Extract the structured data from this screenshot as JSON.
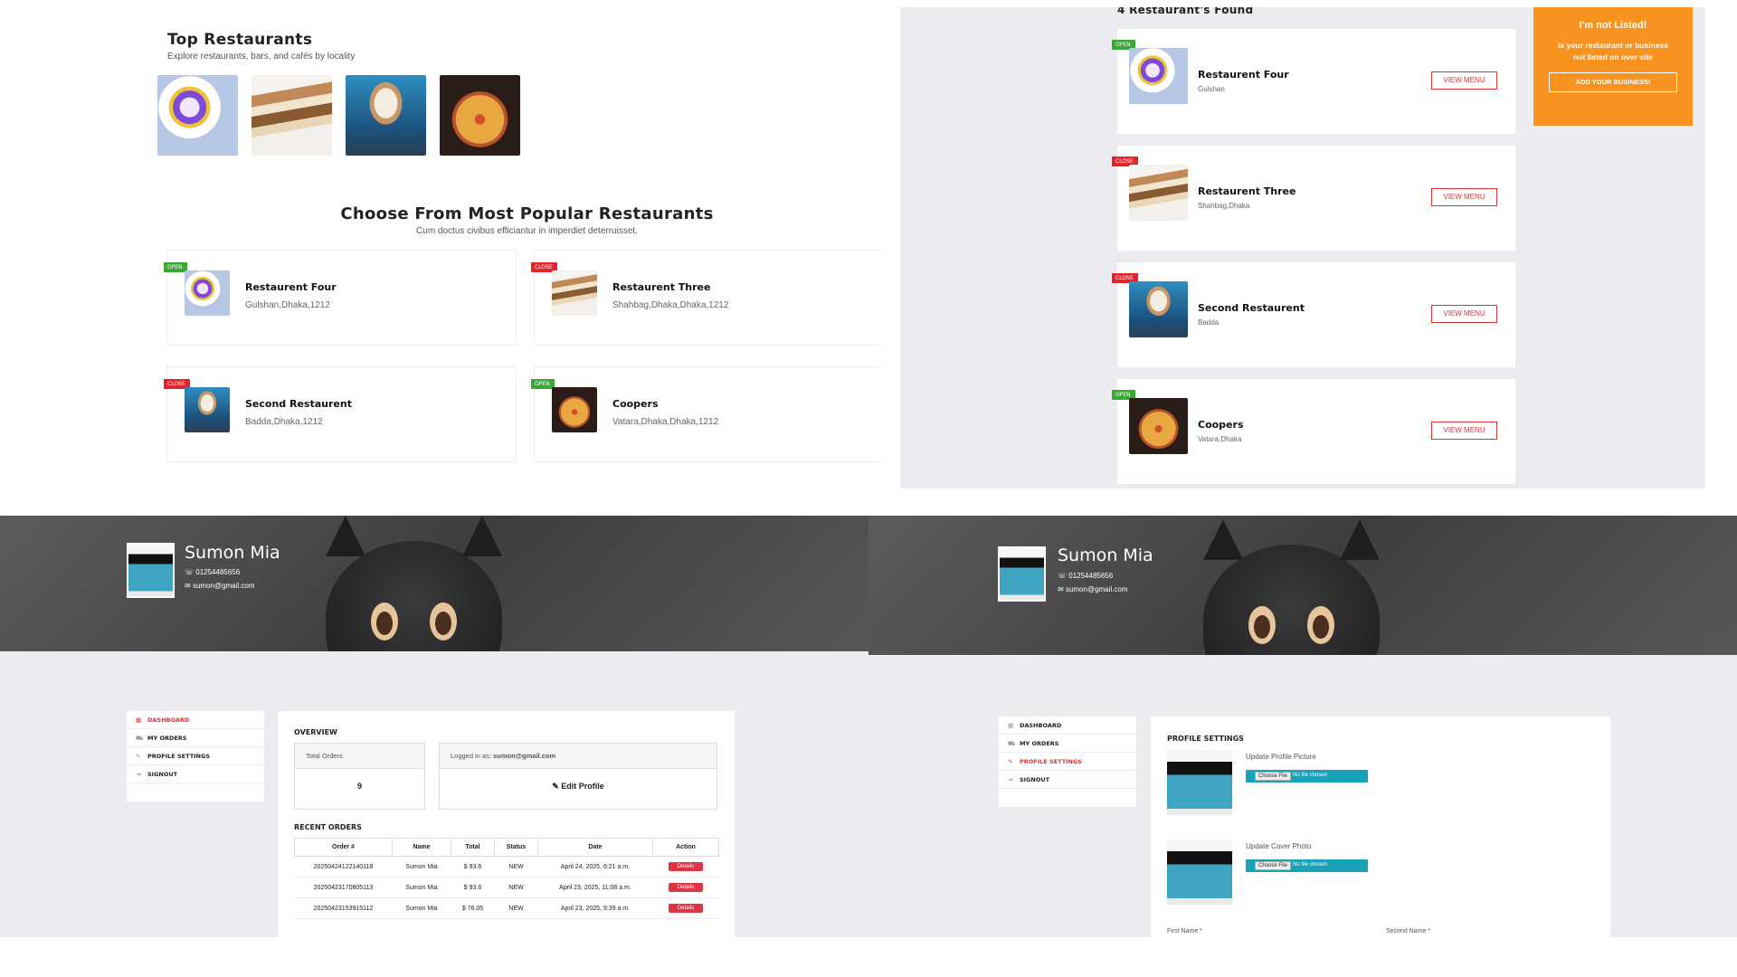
{
  "top_restaurants": {
    "title": "Top Restaurants",
    "subtitle": "Explore restaurants, bars, and cafés by locality"
  },
  "popular": {
    "title": "Choose From Most Popular Restaurants",
    "subtitle": "Cum doctus civibus efficiantur in imperdiet deterruisset.",
    "cards": [
      {
        "status": "OPEN",
        "name": "Restaurent Four",
        "address": "Gulshan,Dhaka,1212"
      },
      {
        "status": "CLOSE",
        "name": "Restaurent Three",
        "address": "Shahbag,Dhaka,Dhaka,1212"
      },
      {
        "status": "CLOSE",
        "name": "Second Restaurent",
        "address": "Badda,Dhaka,1212"
      },
      {
        "status": "OPEN",
        "name": "Coopers",
        "address": "Vatara,Dhaka,Dhaka,1212"
      }
    ]
  },
  "listing": {
    "found": "4 Restaurant's Found",
    "view_menu": "VIEW MENU",
    "items": [
      {
        "status": "OPEN",
        "name": "Restaurent Four",
        "area": "Gulshan"
      },
      {
        "status": "CLOSE",
        "name": "Restaurent Three",
        "area": "Shahbag,Dhaka"
      },
      {
        "status": "CLOSE",
        "name": "Second Restaurent",
        "area": "Badda"
      },
      {
        "status": "OPEN",
        "name": "Coopers",
        "area": "Vatara,Dhaka"
      }
    ],
    "promo": {
      "title": "I'm not Listed!",
      "text": "is your restaurant or business not listed on over site",
      "button": "ADD YOUR BUSINESS!"
    }
  },
  "profile": {
    "name": "Sumon Mia",
    "phone": "01254485656",
    "email": "sumon@gmail.com",
    "menu": [
      "DASHBOARD",
      "MY ORDERS",
      "PROFILE SETTINGS",
      "SIGNOUT"
    ]
  },
  "dashboard": {
    "overview_title": "OVERVIEW",
    "total_orders_label": "Total Orders",
    "total_orders_value": "9",
    "logged_in_label": "Logged in as:",
    "logged_in_email": "sumon@gmail.com",
    "edit_profile": "Edit Profile",
    "recent_title": "RECENT ORDERS",
    "columns": [
      "Order #",
      "Name",
      "Total",
      "Status",
      "Date",
      "Action"
    ],
    "rows": [
      [
        "20250424122140118",
        "Sumon Mia",
        "$ 93.6",
        "NEW",
        "April 24, 2025, 6:21 a.m.",
        "Details"
      ],
      [
        "20250423170805113",
        "Sumon Mia",
        "$ 93.6",
        "NEW",
        "April 23, 2025, 11:08 a.m.",
        "Details"
      ],
      [
        "20250423153915112",
        "Sumon Mia",
        "$ 76.05",
        "NEW",
        "April 23, 2025, 9:39 a.m.",
        "Details"
      ]
    ]
  },
  "settings": {
    "title": "PROFILE SETTINGS",
    "profile_picture_label": "Update Profile Picture",
    "cover_photo_label": "Update Cover Photo",
    "choose_file": "Choose File",
    "no_file": "No file chosen",
    "first_name": "First Name *",
    "second_name": "Second Name *"
  },
  "colors": {
    "accent": "#e3242b",
    "open": "#3aa835",
    "promo": "#f7931e",
    "file_input": "#17a2b8"
  }
}
